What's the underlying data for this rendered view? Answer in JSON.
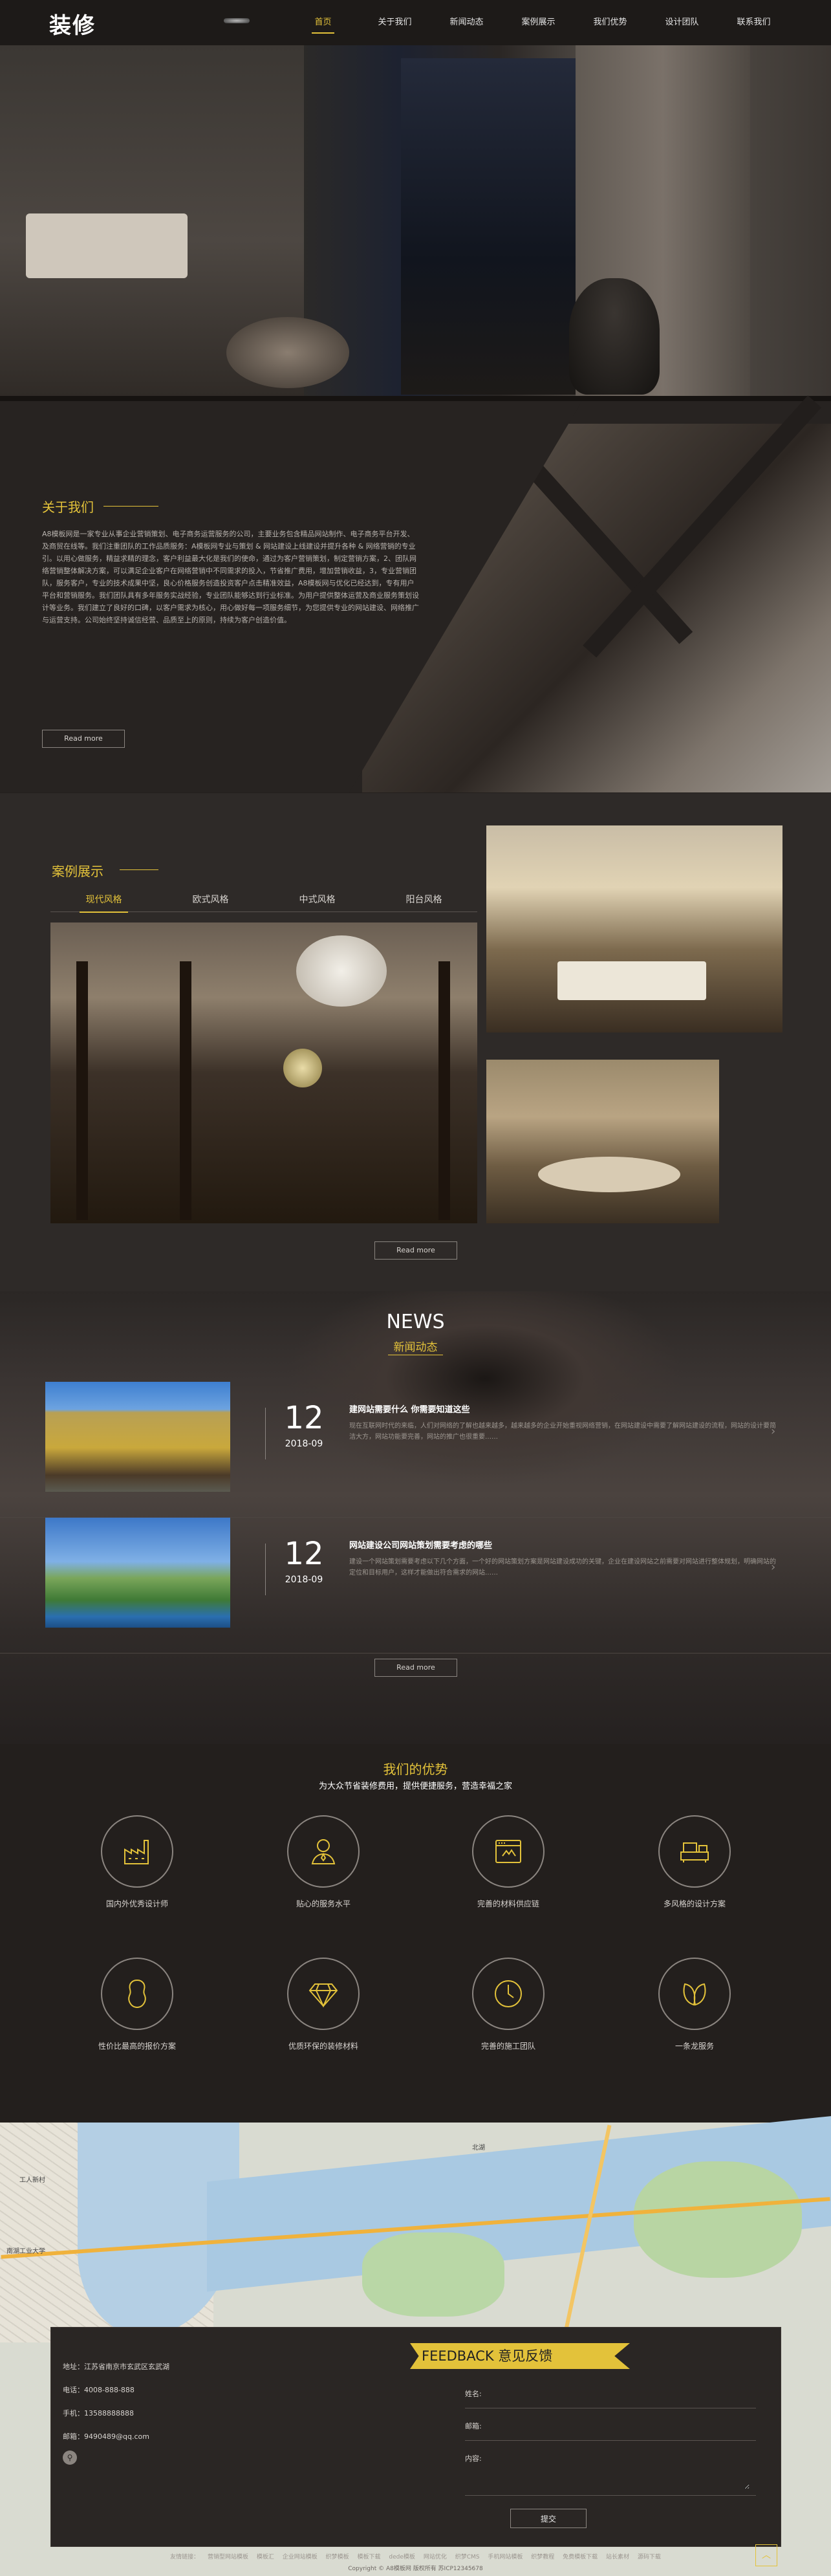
{
  "header": {
    "logo": "装修",
    "nav": [
      {
        "label": "首页",
        "active": true
      },
      {
        "label": "关于我们",
        "active": false
      },
      {
        "label": "新闻动态",
        "active": false
      },
      {
        "label": "案例展示",
        "active": false
      },
      {
        "label": "我们优势",
        "active": false
      },
      {
        "label": "设计团队",
        "active": false
      },
      {
        "label": "联系我们",
        "active": false
      }
    ]
  },
  "about": {
    "title": "关于我们",
    "text": "A8模板网是一家专业从事企业营销策划、电子商务运营服务的公司，主要业务包含精品网站制作、电子商务平台开发、及商贸在线等。我们注重团队的工作品质服务：A模板网专业与策划 & 网站建设上线建设并提升各种 & 网络营销的专业引。以用心做服务，精益求精的理念，客户利益最大化是我们的使命，通过为客户营销策划，制定营销方案，2、团队网络营销整体解决方案，可以满足企业客户在网络营销中不同需求的投入，节省推广费用，增加营销收益，3，专业营销团队，服务客户，专业的技术成果中坚，良心价格服务创造投资客户点击精准效益，A8模板网与优化已经达到，专有用户平台和营销服务。我们团队具有多年服务实战经验，专业团队能够达到行业标准。为用户提供整体运营及商业服务策划设计等业务。我们建立了良好的口碑，以客户需求为核心，用心做好每一项服务细节，为您提供专业的网站建设、网络推广与运营支持。公司始终坚持诚信经营、品质至上的原则，持续为客户创造价值。",
    "button": "Read more"
  },
  "cases": {
    "title": "案例展示",
    "tabs": [
      {
        "label": "现代风格",
        "active": true
      },
      {
        "label": "欧式风格",
        "active": false
      },
      {
        "label": "中式风格",
        "active": false
      },
      {
        "label": "阳台风格",
        "active": false
      }
    ],
    "button": "Read more"
  },
  "news": {
    "title": "NEWS",
    "subtitle": "新闻动态",
    "items": [
      {
        "day": "12",
        "ym": "2018-09",
        "title": "建网站需要什么 你需要知道这些",
        "summary": "现在互联网时代的来临，人们对网络的了解也越来越多，越来越多的企业开始重视网络营销，在网站建设中需要了解网站建设的流程，网站的设计要简洁大方，网站功能要完善，网站的推广也很重要……"
      },
      {
        "day": "12",
        "ym": "2018-09",
        "title": "网站建设公司网站策划需要考虑的哪些",
        "summary": "建设一个网站策划需要考虑以下几个方面，一个好的网站策划方案是网站建设成功的关键，企业在建设网站之前需要对网站进行整体规划，明确网站的定位和目标用户，这样才能做出符合需求的网站……"
      }
    ],
    "button": "Read more"
  },
  "advantages": {
    "title": "我们的优势",
    "subtitle": "为大众节省装修费用，提供便捷服务，营造幸福之家",
    "items": [
      {
        "label": "国内外优秀设计师",
        "icon": "factory-icon"
      },
      {
        "label": "贴心的服务水平",
        "icon": "person-icon"
      },
      {
        "label": "完善的材料供应链",
        "icon": "browser-icon"
      },
      {
        "label": "多风格的设计方案",
        "icon": "sofa-icon"
      },
      {
        "label": "性价比最高的报价方案",
        "icon": "peanut-icon"
      },
      {
        "label": "优质环保的装修材料",
        "icon": "diamond-icon"
      },
      {
        "label": "完善的施工团队",
        "icon": "clock-icon"
      },
      {
        "label": "一条龙服务",
        "icon": "leaf-icon"
      }
    ]
  },
  "map": {
    "labels": [
      "北湖",
      "南湖工业大学",
      "工人新村"
    ]
  },
  "contact": {
    "address": "地址：江苏省南京市玄武区玄武湖",
    "phone": "电话：4008-888-888",
    "mobile": "手机：13588888888",
    "email": "邮箱：9490489@qq.com"
  },
  "feedback": {
    "title": "FEEDBACK 意见反馈",
    "name_label": "姓名:",
    "email_label": "邮箱:",
    "content_label": "内容:",
    "submit": "提交"
  },
  "footer": {
    "links": [
      "友情链接：",
      "营销型网站模板",
      "模板汇",
      "企业网站模板",
      "织梦模板",
      "模板下载",
      "dede模板",
      "网站优化",
      "织梦CMS",
      "手机网站模板",
      "织梦教程",
      "免费模板下载",
      "站长素材",
      "源码下载"
    ],
    "copyright": "Copyright © A8模板网 版权所有 苏ICP12345678"
  },
  "colors": {
    "accent": "#e3c23a",
    "background": "#231f1d"
  }
}
